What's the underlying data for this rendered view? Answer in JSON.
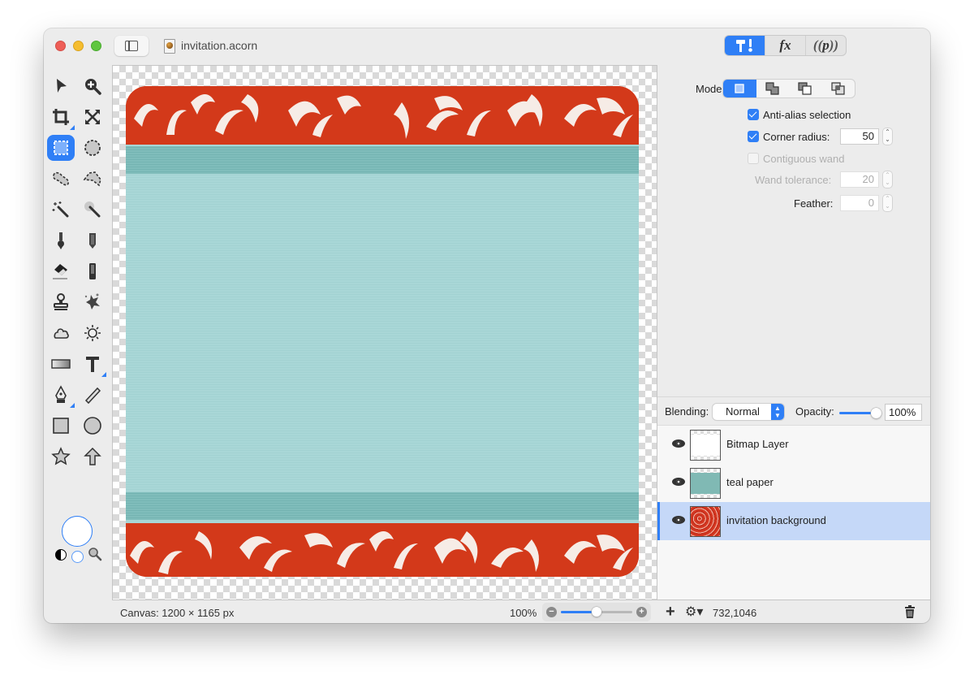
{
  "window": {
    "title": "invitation.acorn"
  },
  "toolbar": {
    "inspector_tabs": [
      {
        "name": "tools",
        "label": "🔨!",
        "icon": "hammer-icon",
        "active": true
      },
      {
        "name": "effects",
        "label": "fx",
        "icon": "fx-icon",
        "active": false
      },
      {
        "name": "properties",
        "label": "((p))",
        "icon": "properties-icon",
        "active": false
      }
    ]
  },
  "tools": [
    {
      "name": "select-arrow",
      "icon": "arrow-icon"
    },
    {
      "name": "zoom",
      "icon": "zoom-in-icon"
    },
    {
      "name": "crop",
      "icon": "crop-icon",
      "has_submenu": true
    },
    {
      "name": "transform",
      "icon": "expand-icon"
    },
    {
      "name": "rect-select",
      "icon": "rect-select-icon",
      "active": true
    },
    {
      "name": "ellipse-select",
      "icon": "ellipse-select-icon"
    },
    {
      "name": "lasso",
      "icon": "lasso-icon"
    },
    {
      "name": "polygon-lasso",
      "icon": "polygon-lasso-icon"
    },
    {
      "name": "magic-wand",
      "icon": "magic-wand-icon"
    },
    {
      "name": "color-wand",
      "icon": "color-wand-icon"
    },
    {
      "name": "brush",
      "icon": "brush-icon"
    },
    {
      "name": "pencil",
      "icon": "pencil-icon"
    },
    {
      "name": "eraser",
      "icon": "eraser-icon"
    },
    {
      "name": "smudge",
      "icon": "smudge-icon"
    },
    {
      "name": "clone-stamp",
      "icon": "stamp-icon"
    },
    {
      "name": "splatter",
      "icon": "splatter-icon"
    },
    {
      "name": "burn",
      "icon": "cloud-icon"
    },
    {
      "name": "dodge",
      "icon": "sun-icon"
    },
    {
      "name": "gradient",
      "icon": "gradient-icon"
    },
    {
      "name": "text",
      "icon": "text-icon",
      "has_submenu": true
    },
    {
      "name": "pen",
      "icon": "pen-nib-icon",
      "has_submenu": true
    },
    {
      "name": "line",
      "icon": "line-icon"
    },
    {
      "name": "rectangle",
      "icon": "square-icon"
    },
    {
      "name": "oval",
      "icon": "circle-icon"
    },
    {
      "name": "star",
      "icon": "star-icon"
    },
    {
      "name": "arrow-shape",
      "icon": "up-arrow-icon"
    }
  ],
  "colors": {
    "accent": "#2f7ff6",
    "fill_color": "#ffffff",
    "stroke_color": "#ffffff",
    "artwork_red": "#d3391a",
    "artwork_teal": "#a8d6d6",
    "artwork_teal_band": "#7fbcba"
  },
  "inspector": {
    "mode_label": "Mode:",
    "mode_options": [
      {
        "name": "new-selection",
        "active": true
      },
      {
        "name": "add-to-selection",
        "active": false
      },
      {
        "name": "subtract-from-selection",
        "active": false
      },
      {
        "name": "intersect-selection",
        "active": false
      }
    ],
    "anti_alias": {
      "label": "Anti-alias selection",
      "checked": true
    },
    "corner_radius": {
      "label": "Corner radius:",
      "checked": true,
      "value": "50"
    },
    "contiguous_wand": {
      "label": "Contiguous wand",
      "checked": false,
      "disabled": true
    },
    "wand_tolerance": {
      "label": "Wand tolerance:",
      "value": "20",
      "disabled": true
    },
    "feather": {
      "label": "Feather:",
      "value": "0"
    }
  },
  "layers_panel": {
    "blending_label": "Blending:",
    "blending_value": "Normal",
    "opacity_label": "Opacity:",
    "opacity_value": "100%",
    "opacity_fraction": 1.0,
    "layers": [
      {
        "name": "Bitmap Layer",
        "visible": true,
        "selected": false,
        "thumb": "white"
      },
      {
        "name": "teal paper",
        "visible": true,
        "selected": false,
        "thumb": "teal"
      },
      {
        "name": "invitation background",
        "visible": true,
        "selected": true,
        "thumb": "red"
      }
    ]
  },
  "status": {
    "canvas_size": "Canvas: 1200 × 1165 px",
    "zoom_level": "100%",
    "zoom_slider_fraction": 0.5,
    "cursor_coords": "732,1046",
    "add_label": "+",
    "gear_label": "⚙▾"
  }
}
